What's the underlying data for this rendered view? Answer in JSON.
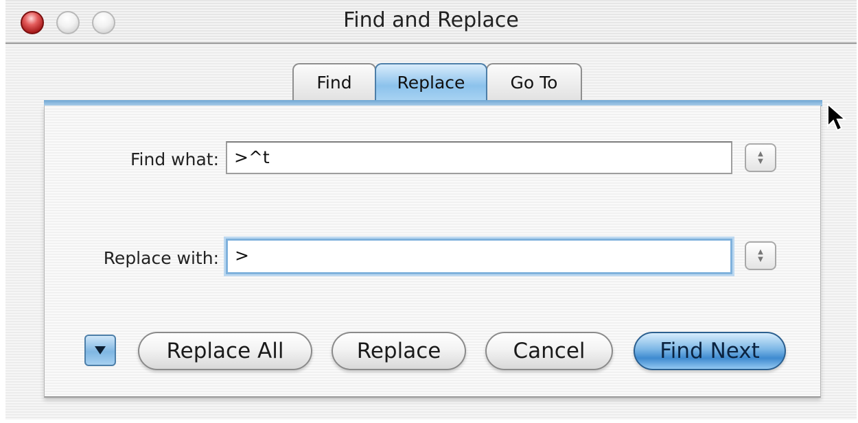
{
  "window": {
    "title": "Find and Replace"
  },
  "tabs": [
    {
      "label": "Find",
      "selected": false
    },
    {
      "label": "Replace",
      "selected": true
    },
    {
      "label": "Go To",
      "selected": false
    }
  ],
  "form": {
    "find_label": "Find what:",
    "find_value": ">^t",
    "replace_label": "Replace with:",
    "replace_value": ">"
  },
  "buttons": {
    "replace_all": "Replace All",
    "replace": "Replace",
    "cancel": "Cancel",
    "find_next": "Find Next"
  },
  "icons": {
    "close": "close-icon",
    "minimize": "minimize-icon",
    "zoom": "zoom-icon",
    "disclosure": "triangle-down-icon",
    "stepper": "stepper-arrows-icon",
    "cursor": "arrow-cursor-icon"
  },
  "colors": {
    "accent": "#7fb6e2",
    "close_red": "#d83a3a",
    "default_button": "#3f8bd0"
  }
}
